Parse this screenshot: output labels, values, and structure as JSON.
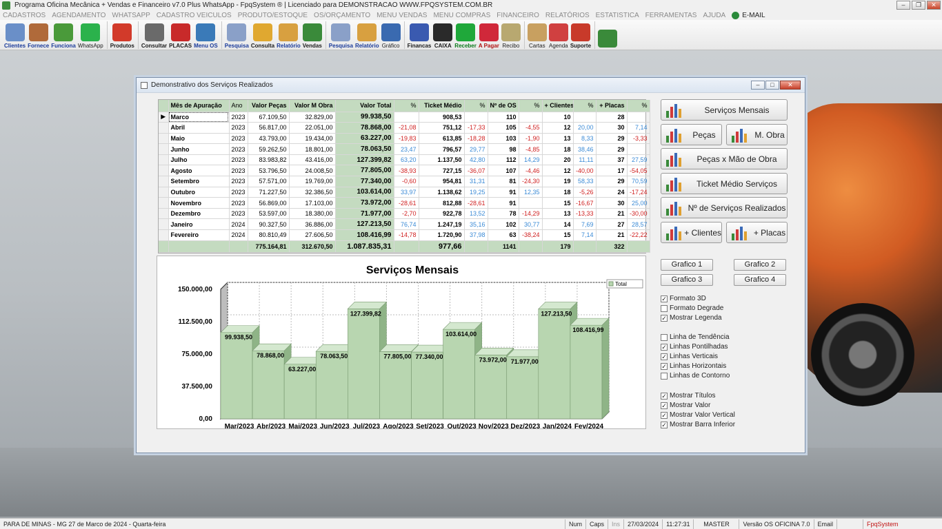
{
  "window": {
    "title": "Programa Oficina Mecânica + Vendas e Financeiro v7.0 Plus WhatsApp - FpqSystem ® | Licenciado para  DEMONSTRACAO WWW.FPQSYSTEM.COM.BR"
  },
  "menu": [
    "CADASTROS",
    "AGENDAMENTO",
    "WHATSAPP",
    "CADASTRO VEICULOS",
    "PRODUTO/ESTOQUE",
    "OS/ORÇAMENTO",
    "MENU VENDAS",
    "MENU COMPRAS",
    "FINANCEIRO",
    "RELATÓRIOS",
    "ESTATISTICA",
    "FERRAMENTAS",
    "AJUDA"
  ],
  "menu_email": "E-MAIL",
  "toolbar": [
    {
      "label": "Clientes",
      "icon": "clients-icon",
      "style": "blue",
      "color": "#6a8fc8"
    },
    {
      "label": "Fornece",
      "icon": "supplier-icon",
      "style": "blue",
      "color": "#b06a3a"
    },
    {
      "label": "Funciona",
      "icon": "employee-icon",
      "style": "blue",
      "color": "#4a9a3a"
    },
    {
      "label": "WhatsApp",
      "icon": "whatsapp-icon",
      "style": "plain",
      "color": "#2bb24c"
    },
    {
      "label": "Produtos",
      "icon": "products-icon",
      "style": "",
      "color": "#d23a2a"
    },
    {
      "label": "Consultar",
      "icon": "tire-icon",
      "style": "",
      "color": "#6a6a6a"
    },
    {
      "label": "PLACAS",
      "icon": "car-icon",
      "style": "",
      "color": "#c82a2a"
    },
    {
      "label": "Menu OS",
      "icon": "menu-os-icon",
      "style": "blue",
      "color": "#3a7ab8"
    },
    {
      "label": "Pesquisa",
      "icon": "search-doc-icon",
      "style": "blue",
      "color": "#8aa0c8"
    },
    {
      "label": "Consulta",
      "icon": "folder-icon",
      "style": "",
      "color": "#e0a830"
    },
    {
      "label": "Relatório",
      "icon": "report-icon",
      "style": "blue",
      "color": "#d8a040"
    },
    {
      "label": "Vendas",
      "icon": "cart-icon",
      "style": "",
      "color": "#3a8a3a"
    },
    {
      "label": "Pesquisa",
      "icon": "search-doc-icon",
      "style": "blue",
      "color": "#8aa0c8"
    },
    {
      "label": "Relatório",
      "icon": "report-icon",
      "style": "blue",
      "color": "#d8a040"
    },
    {
      "label": "Gráfico",
      "icon": "chart-icon",
      "style": "plain",
      "color": "#3a6ab0"
    },
    {
      "label": "Financas",
      "icon": "finance-icon",
      "style": "",
      "color": "#3a5ab0"
    },
    {
      "label": "CAIXA",
      "icon": "cashbox-icon",
      "style": "",
      "color": "#2a2a2a"
    },
    {
      "label": "Receber",
      "icon": "receive-icon",
      "style": "green",
      "color": "#1fa83a"
    },
    {
      "label": "A Pagar",
      "icon": "pay-icon",
      "style": "red",
      "color": "#d0283a"
    },
    {
      "label": "Recibo",
      "icon": "receipt-icon",
      "style": "plain",
      "color": "#b8a870"
    },
    {
      "label": "Cartas",
      "icon": "letter-icon",
      "style": "plain",
      "color": "#c8a060"
    },
    {
      "label": "Agenda",
      "icon": "calendar-icon",
      "style": "plain",
      "color": "#d04040"
    },
    {
      "label": "Suporte",
      "icon": "support-icon",
      "style": "",
      "color": "#c83a2a"
    },
    {
      "label": "",
      "icon": "exit-icon",
      "style": "",
      "color": "#3a8a3a"
    }
  ],
  "dialog": {
    "title": "Demonstrativo dos Serviços Realizados"
  },
  "grid": {
    "headers": [
      "Mês de Apuração",
      "Ano",
      "Valor Peças",
      "Valor M Obra",
      "Valor Total",
      "%",
      "Ticket Médio",
      "%",
      "Nº de OS",
      "%",
      "+ Clientes",
      "%",
      "+ Placas",
      "%"
    ],
    "rows": [
      {
        "mes": "Marco",
        "ano": "2023",
        "pecas": "67.109,50",
        "mobra": "32.829,00",
        "total": "99.938,50",
        "p1": "",
        "ticket": "908,53",
        "p2": "",
        "os": "110",
        "p3": "",
        "cli": "10",
        "p4": "",
        "placas": "28",
        "p5": ""
      },
      {
        "mes": "Abril",
        "ano": "2023",
        "pecas": "56.817,00",
        "mobra": "22.051,00",
        "total": "78.868,00",
        "p1": "-21,08",
        "ticket": "751,12",
        "p2": "-17,33",
        "os": "105",
        "p3": "-4,55",
        "cli": "12",
        "p4": "20,00",
        "placas": "30",
        "p5": "7,14"
      },
      {
        "mes": "Maio",
        "ano": "2023",
        "pecas": "43.793,00",
        "mobra": "19.434,00",
        "total": "63.227,00",
        "p1": "-19,83",
        "ticket": "613,85",
        "p2": "-18,28",
        "os": "103",
        "p3": "-1,90",
        "cli": "13",
        "p4": "8,33",
        "placas": "29",
        "p5": "-3,33"
      },
      {
        "mes": "Junho",
        "ano": "2023",
        "pecas": "59.262,50",
        "mobra": "18.801,00",
        "total": "78.063,50",
        "p1": "23,47",
        "ticket": "796,57",
        "p2": "29,77",
        "os": "98",
        "p3": "-4,85",
        "cli": "18",
        "p4": "38,46",
        "placas": "29",
        "p5": ""
      },
      {
        "mes": "Julho",
        "ano": "2023",
        "pecas": "83.983,82",
        "mobra": "43.416,00",
        "total": "127.399,82",
        "p1": "63,20",
        "ticket": "1.137,50",
        "p2": "42,80",
        "os": "112",
        "p3": "14,29",
        "cli": "20",
        "p4": "11,11",
        "placas": "37",
        "p5": "27,59"
      },
      {
        "mes": "Agosto",
        "ano": "2023",
        "pecas": "53.796,50",
        "mobra": "24.008,50",
        "total": "77.805,00",
        "p1": "-38,93",
        "ticket": "727,15",
        "p2": "-36,07",
        "os": "107",
        "p3": "-4,46",
        "cli": "12",
        "p4": "-40,00",
        "placas": "17",
        "p5": "-54,05"
      },
      {
        "mes": "Setembro",
        "ano": "2023",
        "pecas": "57.571,00",
        "mobra": "19.769,00",
        "total": "77.340,00",
        "p1": "-0,60",
        "ticket": "954,81",
        "p2": "31,31",
        "os": "81",
        "p3": "-24,30",
        "cli": "19",
        "p4": "58,33",
        "placas": "29",
        "p5": "70,59"
      },
      {
        "mes": "Outubro",
        "ano": "2023",
        "pecas": "71.227,50",
        "mobra": "32.386,50",
        "total": "103.614,00",
        "p1": "33,97",
        "ticket": "1.138,62",
        "p2": "19,25",
        "os": "91",
        "p3": "12,35",
        "cli": "18",
        "p4": "-5,26",
        "placas": "24",
        "p5": "-17,24"
      },
      {
        "mes": "Novembro",
        "ano": "2023",
        "pecas": "56.869,00",
        "mobra": "17.103,00",
        "total": "73.972,00",
        "p1": "-28,61",
        "ticket": "812,88",
        "p2": "-28,61",
        "os": "91",
        "p3": "",
        "cli": "15",
        "p4": "-16,67",
        "placas": "30",
        "p5": "25,00"
      },
      {
        "mes": "Dezembro",
        "ano": "2023",
        "pecas": "53.597,00",
        "mobra": "18.380,00",
        "total": "71.977,00",
        "p1": "-2,70",
        "ticket": "922,78",
        "p2": "13,52",
        "os": "78",
        "p3": "-14,29",
        "cli": "13",
        "p4": "-13,33",
        "placas": "21",
        "p5": "-30,00"
      },
      {
        "mes": "Janeiro",
        "ano": "2024",
        "pecas": "90.327,50",
        "mobra": "36.886,00",
        "total": "127.213,50",
        "p1": "76,74",
        "ticket": "1.247,19",
        "p2": "35,16",
        "os": "102",
        "p3": "30,77",
        "cli": "14",
        "p4": "7,69",
        "placas": "27",
        "p5": "28,57"
      },
      {
        "mes": "Fevereiro",
        "ano": "2024",
        "pecas": "80.810,49",
        "mobra": "27.606,50",
        "total": "108.416,99",
        "p1": "-14,78",
        "ticket": "1.720,90",
        "p2": "37,98",
        "os": "63",
        "p3": "-38,24",
        "cli": "15",
        "p4": "7,14",
        "placas": "21",
        "p5": "-22,22"
      }
    ],
    "footer": {
      "pecas": "775.164,81",
      "mobra": "312.670,50",
      "total": "1.087.835,31",
      "ticket": "977,66",
      "os": "1141",
      "cli": "179",
      "placas": "322"
    }
  },
  "chart_data": {
    "type": "bar",
    "title": "Serviços Mensais",
    "categories": [
      "Mar/2023",
      "Abr/2023",
      "Mai/2023",
      "Jun/2023",
      "Jul/2023",
      "Ago/2023",
      "Set/2023",
      "Out/2023",
      "Nov/2023",
      "Dez/2023",
      "Jan/2024",
      "Fev/2024"
    ],
    "series": [
      {
        "name": "Total",
        "values": [
          99938.5,
          78868.0,
          63227.0,
          78063.5,
          127399.82,
          77805.0,
          77340.0,
          103614.0,
          73972.0,
          71977.0,
          127213.5,
          108416.99
        ]
      }
    ],
    "value_labels": [
      "99.938,50",
      "78.868,00",
      "63.227,00",
      "78.063,50",
      "127.399,82",
      "77.805,00",
      "77.340,00",
      "103.614,00",
      "73.972,00",
      "71.977,00",
      "127.213,50",
      "108.416,99"
    ],
    "y_ticks": [
      "0,00",
      "37.500,00",
      "75.000,00",
      "112.500,00",
      "150.000,00"
    ],
    "ylim": [
      0,
      150000
    ],
    "grid": true,
    "legend": "top-right",
    "three_d": true,
    "bar_color": "#b8d6b0"
  },
  "side_buttons": {
    "servicos": "Serviços Mensais",
    "pecas": "Peças",
    "mobra": "M. Obra",
    "pecas_mobra": "Peças x Mão de Obra",
    "ticket": "Ticket Médio Serviços",
    "num_servicos": "Nº de Serviços Realizados",
    "clientes": "+ Clientes",
    "placas": "+ Placas"
  },
  "grafico_buttons": [
    "Grafico 1",
    "Grafico 2",
    "Grafico 3",
    "Grafico 4"
  ],
  "options": [
    {
      "label": "Formato 3D",
      "checked": true
    },
    {
      "label": "Formato Degrade",
      "checked": false
    },
    {
      "label": "Mostrar Legenda",
      "checked": true
    },
    {
      "label": "Linha de Tendência",
      "checked": false
    },
    {
      "label": "Linhas Pontilhadas",
      "checked": true
    },
    {
      "label": "Linhas Verticais",
      "checked": true
    },
    {
      "label": "Linhas Horizontais",
      "checked": true
    },
    {
      "label": "Linhas de Contorno",
      "checked": false
    },
    {
      "label": "Mostrar Títulos",
      "checked": true
    },
    {
      "label": "Mostrar Valor",
      "checked": true
    },
    {
      "label": "Mostrar Valor Vertical",
      "checked": true
    },
    {
      "label": "Mostrar Barra Inferior",
      "checked": true
    }
  ],
  "status": {
    "location": "PARA DE MINAS - MG 27 de Marco de 2024 - Quarta-feira",
    "num": "Num",
    "caps": "Caps",
    "ins": "Ins",
    "date": "27/03/2024",
    "time": "11:27:31",
    "user": "MASTER",
    "version": "Versão OS OFICINA 7.0",
    "email": "Email",
    "brand": "FpqSystem"
  }
}
